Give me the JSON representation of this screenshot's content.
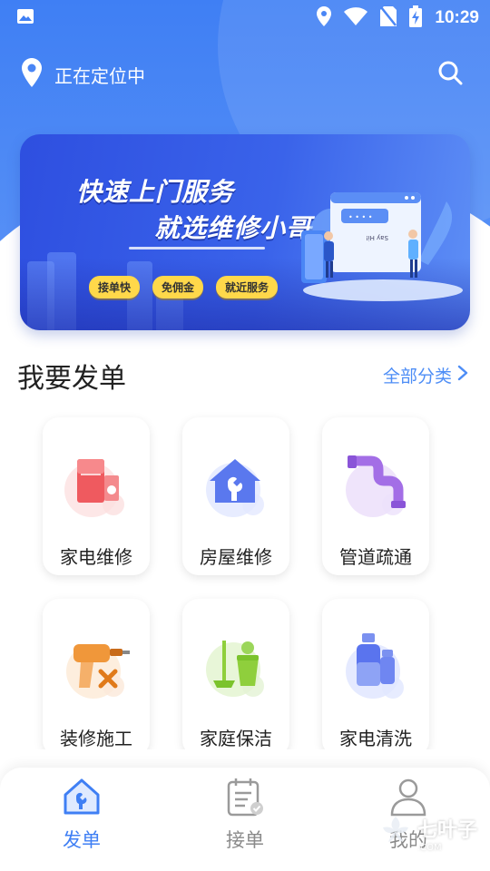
{
  "status_bar": {
    "time": "10:29",
    "icons": [
      "image-icon",
      "location-icon",
      "wifi-icon",
      "no-sim-icon",
      "battery-charging-icon"
    ]
  },
  "header": {
    "location_text": "正在定位中",
    "icons": [
      "location-pin-icon",
      "search-icon"
    ]
  },
  "banner": {
    "title_line1": "快速上门服务",
    "title_line2": "就选维修小哥",
    "tags": [
      "接单快",
      "免佣金",
      "就近服务"
    ],
    "screen_caption": "Say Hi!"
  },
  "section": {
    "title": "我要发单",
    "view_all": "全部分类"
  },
  "services": [
    {
      "label": "家电维修",
      "icon": "appliance-repair-icon"
    },
    {
      "label": "房屋维修",
      "icon": "house-repair-icon"
    },
    {
      "label": "管道疏通",
      "icon": "pipe-clearing-icon"
    },
    {
      "label": "装修施工",
      "icon": "renovation-drill-icon"
    },
    {
      "label": "家庭保洁",
      "icon": "home-cleaning-icon"
    },
    {
      "label": "家电清洗",
      "icon": "appliance-cleaning-icon"
    }
  ],
  "bottom_nav": [
    {
      "label": "发单",
      "icon": "post-order-icon",
      "active": true
    },
    {
      "label": "接单",
      "icon": "accept-order-icon",
      "active": false
    },
    {
      "label": "我的",
      "icon": "profile-icon",
      "active": false
    }
  ],
  "watermark": {
    "text": "七叶子",
    "sub": ".COM"
  },
  "colors": {
    "primary": "#3f7ff4",
    "accent": "#4d8df6",
    "tag": "#ffd84a"
  }
}
